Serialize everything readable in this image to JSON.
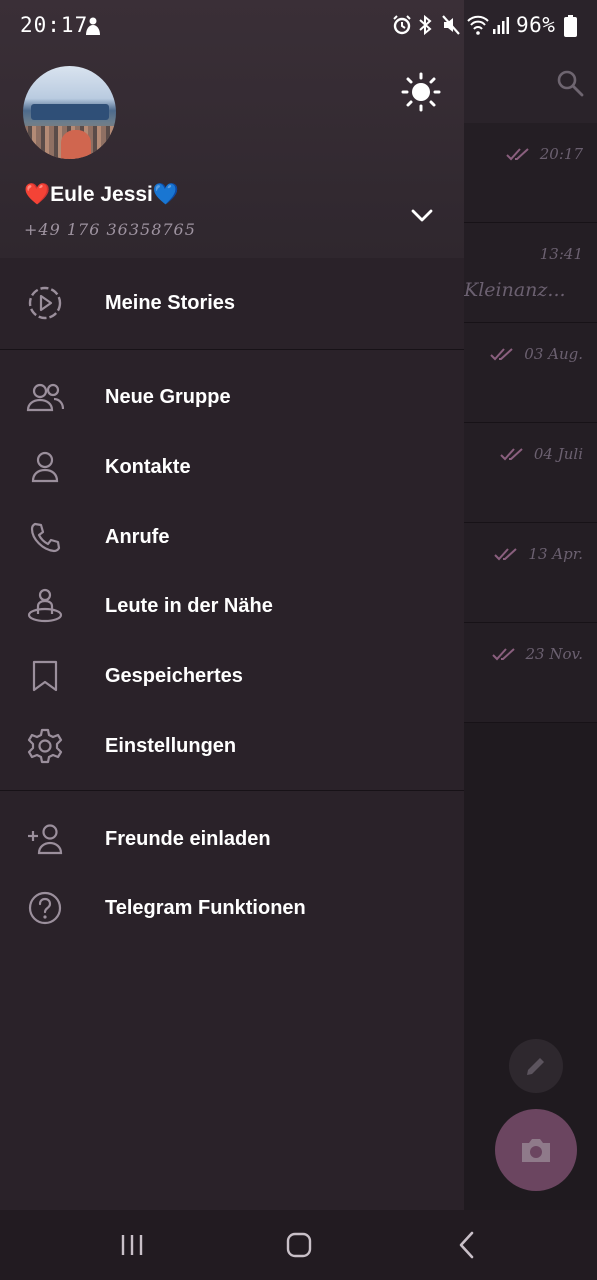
{
  "status_bar": {
    "time": "20:17",
    "battery": "96%"
  },
  "drawer": {
    "user": {
      "name": "❤️Eule Jessi💙",
      "phone": "+49 176 36358765"
    },
    "menu": [
      {
        "label": "Meine Stories",
        "icon": "stories-icon"
      },
      {
        "label": "Neue Gruppe",
        "icon": "group-icon"
      },
      {
        "label": "Kontakte",
        "icon": "contacts-icon"
      },
      {
        "label": "Anrufe",
        "icon": "phone-icon"
      },
      {
        "label": "Leute in der Nähe",
        "icon": "nearby-people-icon"
      },
      {
        "label": "Gespeichertes",
        "icon": "bookmark-icon"
      },
      {
        "label": "Einstellungen",
        "icon": "gear-icon"
      },
      {
        "label": "Freunde einladen",
        "icon": "add-friend-icon"
      },
      {
        "label": "Telegram Funktionen",
        "icon": "help-icon"
      }
    ]
  },
  "background_chats": [
    {
      "time": "20:17",
      "preview": ""
    },
    {
      "time": "13:41",
      "preview": "Kleinanz..."
    },
    {
      "time": "03 Aug.",
      "preview": ""
    },
    {
      "time": "04 Juli",
      "preview": ""
    },
    {
      "time": "13 Apr.",
      "preview": ""
    },
    {
      "time": "23 Nov.",
      "preview": ""
    }
  ],
  "colors": {
    "drawer_bg": "#2a2229",
    "accent": "#6b4560",
    "read_ticks": "#8a5f7e"
  }
}
